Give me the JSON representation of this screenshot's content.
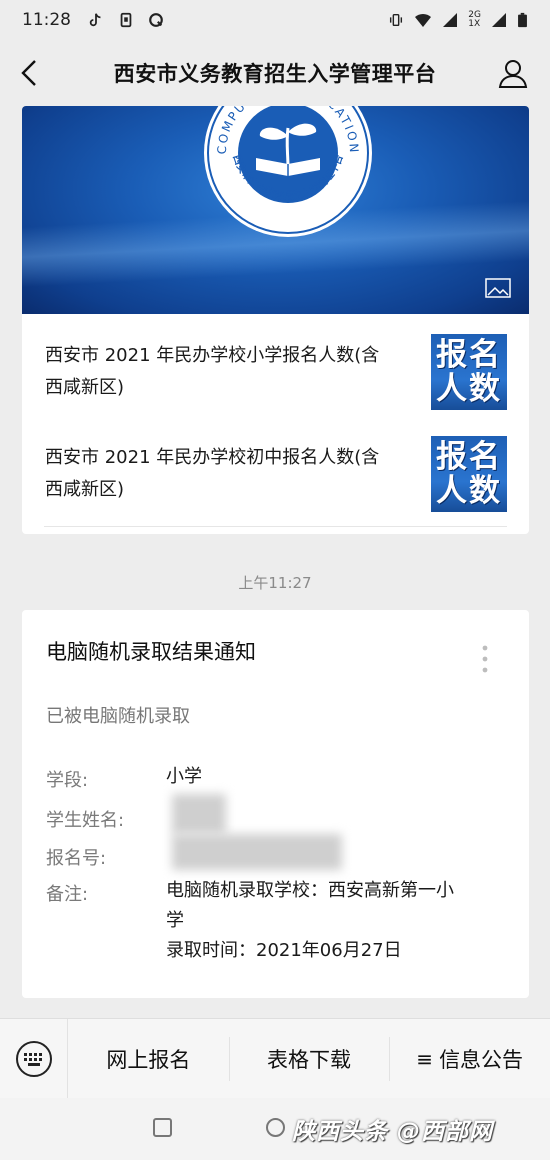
{
  "status_bar": {
    "time": "11:28",
    "network_labels": [
      "2G",
      "1X"
    ]
  },
  "header": {
    "title": "西安市义务教育招生入学管理平台",
    "back_icon": "chevron-left-icon",
    "user_icon": "user-icon"
  },
  "banner": {
    "logo_arc_text": "COMPULSORY EDUCATION",
    "logo_inner_text": "西安市义务教育招生入学管理平台"
  },
  "articles": [
    {
      "title": "西安市2021年民办学校小学报名人数(含西咸新区)",
      "title_line1": "西安市 2021 年民办学校小学报名人数(含",
      "title_line2": "西咸新区)",
      "thumb_line1": "报名",
      "thumb_line2": "人数"
    },
    {
      "title": "西安市2021年民办学校初中报名人数(含西咸新区)",
      "title_line1": "西安市 2021 年民办学校初中报名人数(含",
      "title_line2": "西咸新区)",
      "thumb_line1": "报名",
      "thumb_line2": "人数"
    }
  ],
  "timestamp": "上午11:27",
  "notice": {
    "title": "电脑随机录取结果通知",
    "subtitle": "已被电脑随机录取",
    "fields": [
      {
        "label": "学段:",
        "value": "小学"
      },
      {
        "label": "学生姓名:",
        "value": ""
      },
      {
        "label": "报名号:",
        "value": ""
      },
      {
        "label": "备注:",
        "value_line1": "电脑随机录取学校：西安高新第一小",
        "value_line2": "学",
        "value_line3": "录取时间：2021年06月27日"
      }
    ]
  },
  "bottom_menu": {
    "items": [
      "网上报名",
      "表格下载",
      "信息公告"
    ],
    "menu_glyph": "≡"
  },
  "watermark": "陕西头条 @西部网",
  "colors": {
    "background": "#ededed",
    "card": "#ffffff",
    "banner_blue": "#1a5db6",
    "muted_text": "#7a7a7a"
  }
}
